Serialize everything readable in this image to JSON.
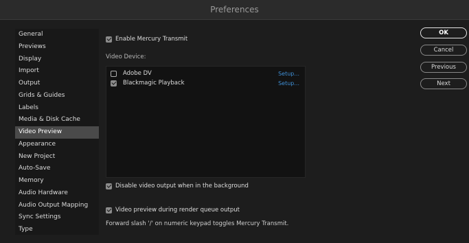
{
  "window": {
    "title": "Preferences"
  },
  "sidebar": {
    "items": [
      {
        "label": "General"
      },
      {
        "label": "Previews"
      },
      {
        "label": "Display"
      },
      {
        "label": "Import"
      },
      {
        "label": "Output"
      },
      {
        "label": "Grids & Guides"
      },
      {
        "label": "Labels"
      },
      {
        "label": "Media & Disk Cache"
      },
      {
        "label": "Video Preview",
        "active": true
      },
      {
        "label": "Appearance"
      },
      {
        "label": "New Project"
      },
      {
        "label": "Auto-Save"
      },
      {
        "label": "Memory"
      },
      {
        "label": "Audio Hardware"
      },
      {
        "label": "Audio Output Mapping"
      },
      {
        "label": "Sync Settings"
      },
      {
        "label": "Type"
      }
    ]
  },
  "main": {
    "enable_mercury_transmit": {
      "label": "Enable Mercury Transmit",
      "checked": true
    },
    "video_device_label": "Video Device:",
    "devices": [
      {
        "name": "Adobe DV",
        "checked": false,
        "setup_label": "Setup..."
      },
      {
        "name": "Blackmagic Playback",
        "checked": true,
        "setup_label": "Setup..."
      }
    ],
    "disable_background": {
      "label": "Disable video output when in the background",
      "checked": true
    },
    "render_queue_preview": {
      "label": "Video preview during render queue output",
      "checked": true
    },
    "hint": "Forward slash '/' on numeric keypad toggles Mercury Transmit."
  },
  "buttons": {
    "ok": "OK",
    "cancel": "Cancel",
    "previous": "Previous",
    "next": "Next"
  },
  "colors": {
    "background": "#1d1d1d",
    "sidebar_bg": "#181818",
    "sidebar_active": "#4a4a4a",
    "link": "#3f8fd6",
    "checkbox_fill": "#8c8c8c"
  }
}
